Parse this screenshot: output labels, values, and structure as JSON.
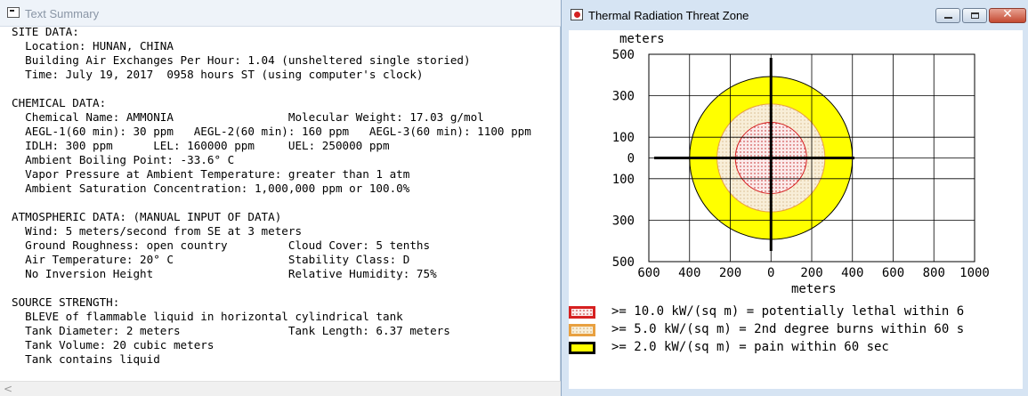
{
  "text_summary_window": {
    "title": "Text Summary",
    "lines": [
      "SITE DATA:",
      "  Location: HUNAN, CHINA",
      "  Building Air Exchanges Per Hour: 1.04 (unsheltered single storied)",
      "  Time: July 19, 2017  0958 hours ST (using computer's clock)",
      "",
      "CHEMICAL DATA:",
      "  Chemical Name: AMMONIA                 Molecular Weight: 17.03 g/mol",
      "  AEGL-1(60 min): 30 ppm   AEGL-2(60 min): 160 ppm   AEGL-3(60 min): 1100 ppm",
      "  IDLH: 300 ppm      LEL: 160000 ppm     UEL: 250000 ppm",
      "  Ambient Boiling Point: -33.6° C",
      "  Vapor Pressure at Ambient Temperature: greater than 1 atm",
      "  Ambient Saturation Concentration: 1,000,000 ppm or 100.0%",
      "",
      "ATMOSPHERIC DATA: (MANUAL INPUT OF DATA)",
      "  Wind: 5 meters/second from SE at 3 meters",
      "  Ground Roughness: open country         Cloud Cover: 5 tenths",
      "  Air Temperature: 20° C                 Stability Class: D",
      "  No Inversion Height                    Relative Humidity: 75%",
      "",
      "SOURCE STRENGTH:",
      "  BLEVE of flammable liquid in horizontal cylindrical tank",
      "  Tank Diameter: 2 meters                Tank Length: 6.37 meters",
      "  Tank Volume: 20 cubic meters",
      "  Tank contains liquid"
    ],
    "scroll_left_glyph": "<"
  },
  "threat_zone_window": {
    "title": "Thermal Radiation Threat Zone",
    "buttons": {
      "minimize_icon": "minimize-icon",
      "maximize_icon": "maximize-icon",
      "close_icon": "close-icon",
      "close_glyph": "✕"
    }
  },
  "chart_data": {
    "type": "threat-zone-plot",
    "y_unit_label": "meters",
    "x_unit_label": "meters",
    "x_ticks": [
      -600,
      -400,
      -200,
      0,
      200,
      400,
      600,
      800,
      1000
    ],
    "x_tick_labels": [
      "600",
      "400",
      "200",
      "0",
      "200",
      "400",
      "600",
      "800",
      "1000"
    ],
    "y_ticks": [
      500,
      300,
      100,
      0,
      -100,
      -300,
      -500
    ],
    "y_tick_labels": [
      "500",
      "300",
      "100",
      "0",
      "100",
      "300",
      "500"
    ],
    "xlim": [
      -600,
      1000
    ],
    "ylim": [
      -500,
      500
    ],
    "grid": true,
    "zones": [
      {
        "label": "red zone",
        "radius_m": 175,
        "color": "#d62020",
        "fill": "#f9e6e6",
        "pattern": "dots-red"
      },
      {
        "label": "orange zone",
        "radius_m": 265,
        "color": "#e8a040",
        "fill": "#f7ecd4",
        "pattern": "dots-tan"
      },
      {
        "label": "yellow zone",
        "radius_m": 400,
        "color": "#000000",
        "fill": "#ffff00",
        "pattern": "solid"
      }
    ],
    "legend": [
      {
        "text": ">= 10.0 kW/(sq m) = potentially lethal within 6",
        "swatch_border": "#d62020",
        "swatch_fill": "#f9e6e6"
      },
      {
        "text": ">= 5.0 kW/(sq m) = 2nd degree burns within 60 s",
        "swatch_border": "#e8a040",
        "swatch_fill": "#f7ecd4"
      },
      {
        "text": ">= 2.0 kW/(sq m) = pain within 60 sec",
        "swatch_border": "#000000",
        "swatch_fill": "#ffff00"
      }
    ]
  }
}
